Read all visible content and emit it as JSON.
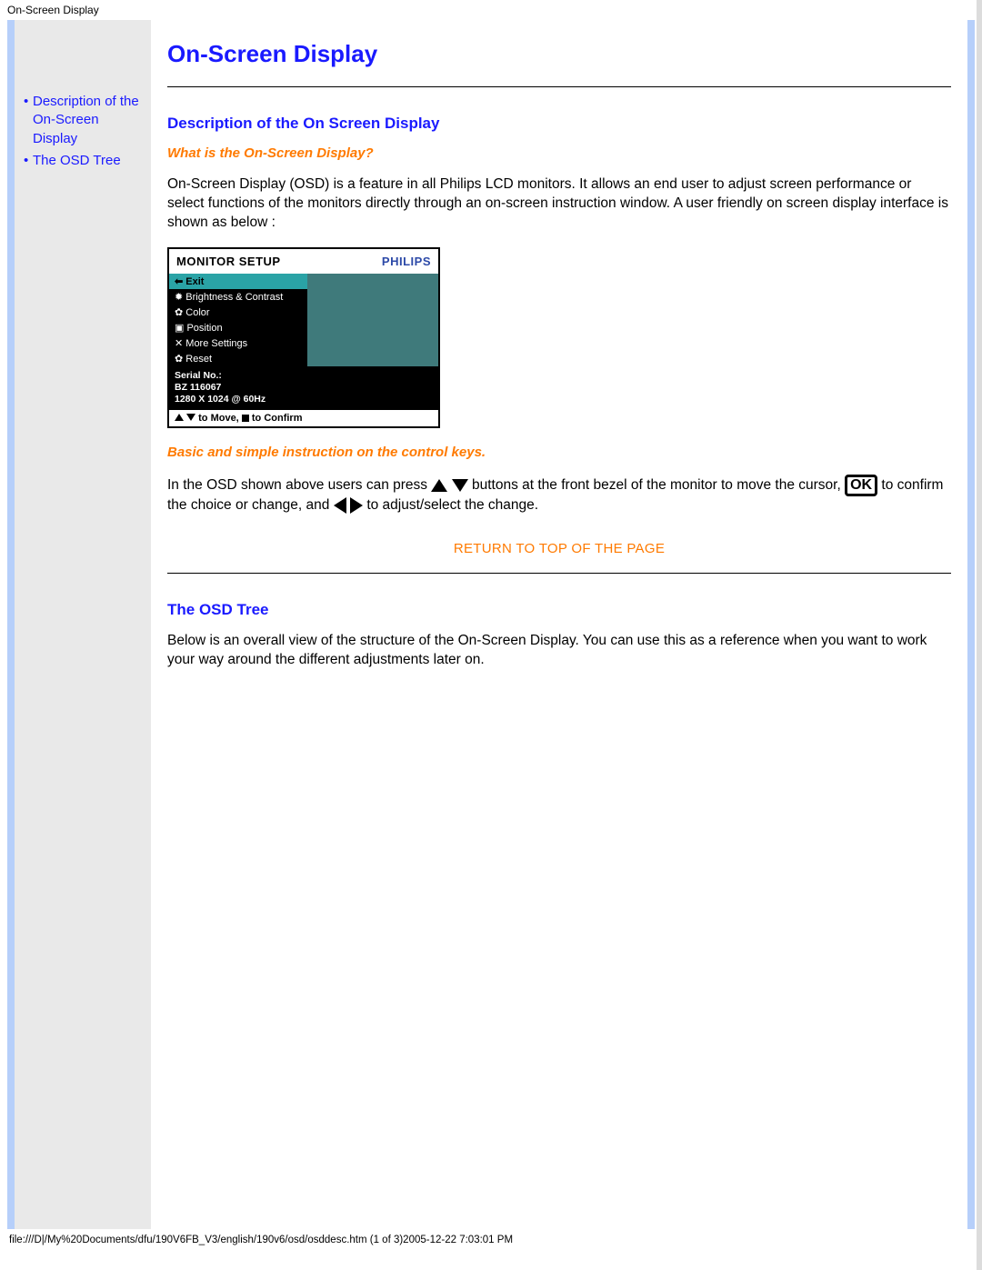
{
  "window_title": "On-Screen Display",
  "page_title": "On-Screen Display",
  "sidebar": {
    "items": [
      {
        "label": "Description of the On-Screen Display"
      },
      {
        "label": "The OSD Tree"
      }
    ]
  },
  "section1": {
    "heading": "Description of the On Screen Display",
    "sub_q": "What is the On-Screen Display?",
    "para": "On-Screen Display (OSD) is a feature in all Philips LCD monitors. It allows an end user to adjust screen performance or select functions of the monitors directly through an on-screen instruction window. A user friendly on screen display interface is shown as below :"
  },
  "osd": {
    "title": "MONITOR SETUP",
    "brand": "PHILIPS",
    "menu": [
      "Exit",
      "Brightness & Contrast",
      "Color",
      "Position",
      "More Settings",
      "Reset"
    ],
    "info": [
      "Serial No.:",
      "BZ 116067",
      "1280 X 1024 @ 60Hz"
    ],
    "foot_move": "to Move,",
    "foot_confirm": "to Confirm"
  },
  "section1b": {
    "sub_q": "Basic and simple instruction on the control keys.",
    "instr_1": "In the OSD shown above users can press",
    "instr_2": "buttons at the front bezel of the monitor to move the cursor,",
    "instr_3": "to confirm the choice or change, and",
    "instr_4": "to adjust/select the change.",
    "ok_label": "OK"
  },
  "return_link": "RETURN TO TOP OF THE PAGE",
  "section2": {
    "heading": "The OSD Tree",
    "para": "Below is an overall view of the structure of the On-Screen Display. You can use this as a reference when you want to work your way around the different adjustments later on."
  },
  "footer_path": "file:///D|/My%20Documents/dfu/190V6FB_V3/english/190v6/osd/osddesc.htm (1 of 3)2005-12-22 7:03:01 PM"
}
